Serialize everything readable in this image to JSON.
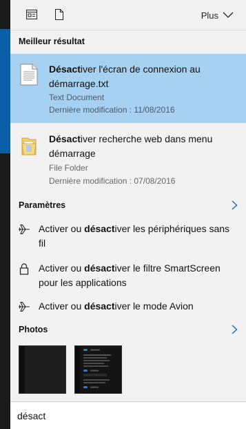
{
  "toolbar": {
    "icons": [
      "document-view-icon",
      "file-icon"
    ],
    "more_label": "Plus"
  },
  "best_result": {
    "section_title": "Meilleur résultat",
    "item": {
      "title_bold": "Désact",
      "title_rest": "iver l'écran de connexion au démarrage.txt",
      "type": "Text Document",
      "modified": "Dernière modification : 11/08/2016"
    }
  },
  "other_results": [
    {
      "title_bold": "Désact",
      "title_rest": "iver recherche web dans menu démarrage",
      "type": "File Folder",
      "modified": "Dernière modification : 07/08/2016"
    }
  ],
  "settings": {
    "section_title": "Paramètres",
    "items": [
      {
        "icon": "airplane-icon",
        "pre": "Activer ou ",
        "bold": "désact",
        "post": "iver les périphériques sans fil"
      },
      {
        "icon": "lock-icon",
        "pre": "Activer ou ",
        "bold": "désact",
        "post": "iver le filtre SmartScreen pour les applications"
      },
      {
        "icon": "airplane-icon",
        "pre": "Activer ou ",
        "bold": "désact",
        "post": "iver le mode Avion"
      }
    ]
  },
  "photos": {
    "section_title": "Photos",
    "count": 2
  },
  "search": {
    "value": "désact"
  },
  "colors": {
    "selected_bg": "#a7d1f1",
    "accent": "#0b5ea8",
    "arrow": "#1e6fc0"
  }
}
